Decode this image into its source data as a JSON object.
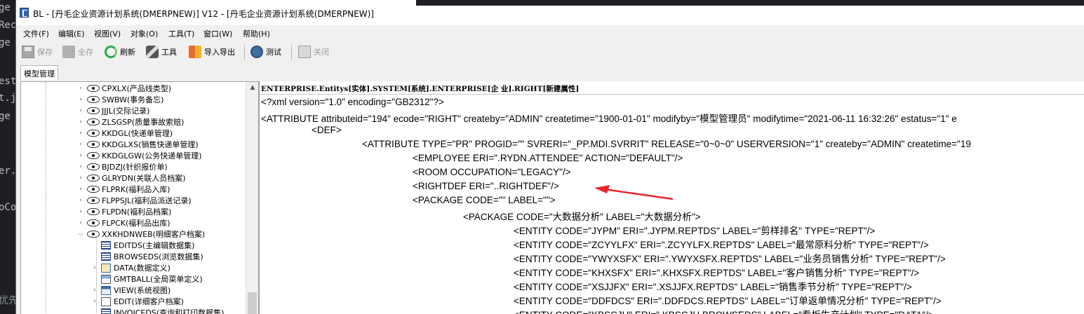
{
  "background_code": {
    "fragments": [
      "ge",
      "Rec",
      "ge",
      "est",
      "t.j",
      "ge",
      "er.",
      "oCo",
      "优先"
    ]
  },
  "window": {
    "title": "BL - [丹毛企业资源计划系统(DMERPNEW)] V12 - [丹毛企业资源计划系统(DMERPNEW)]",
    "icon": "app-icon"
  },
  "menu": [
    {
      "label": "文件(F)"
    },
    {
      "label": "编辑(E)"
    },
    {
      "label": "视图(V)"
    },
    {
      "label": "对象(O)"
    },
    {
      "label": "工具(T)"
    },
    {
      "label": "窗口(W)"
    },
    {
      "label": "帮助(H)"
    }
  ],
  "toolbar": {
    "save": {
      "label": "保存",
      "icon": "save-icon",
      "enabled": false
    },
    "save_all": {
      "label": "全存",
      "icon": "save-all-icon",
      "enabled": false
    },
    "refresh": {
      "label": "刷新",
      "icon": "refresh-icon",
      "enabled": true
    },
    "tools": {
      "label": "工具",
      "icon": "tools-icon",
      "enabled": true
    },
    "import_export": {
      "label": "导入导出",
      "icon": "import-export-icon",
      "enabled": true
    },
    "test": {
      "label": "测试",
      "icon": "test-icon",
      "enabled": true
    },
    "close": {
      "label": "关闭",
      "icon": "close-icon",
      "enabled": false
    }
  },
  "tabs": [
    {
      "label": "模型管理",
      "active": true
    }
  ],
  "tree": {
    "nodes": [
      {
        "label": "CPXLX(产品线类型)",
        "icon": "eye-icon",
        "expanded": false
      },
      {
        "label": "SWBW(事务备忘)",
        "icon": "eye-icon",
        "expanded": false
      },
      {
        "label": "JJJL(交际记录)",
        "icon": "eye-icon",
        "expanded": false
      },
      {
        "label": "ZLSGSP(质量事故索赔)",
        "icon": "eye-icon",
        "expanded": false
      },
      {
        "label": "KKDGL(快递单管理)",
        "icon": "eye-icon",
        "expanded": false
      },
      {
        "label": "KKDGLXS(销售快递单管理)",
        "icon": "eye-icon",
        "expanded": false
      },
      {
        "label": "KKDGLGW(公务快递单管理)",
        "icon": "eye-icon",
        "expanded": false
      },
      {
        "label": "BJDZJ(针织报价单)",
        "icon": "eye-icon",
        "expanded": false
      },
      {
        "label": "GLRYDN(关联人员档案)",
        "icon": "eye-icon",
        "expanded": false
      },
      {
        "label": "FLPRK(福利品入库)",
        "icon": "eye-icon",
        "expanded": false
      },
      {
        "label": "FLPPSJL(福利品派送记录)",
        "icon": "eye-icon",
        "expanded": false
      },
      {
        "label": "FLPDN(福利品档案)",
        "icon": "eye-icon",
        "expanded": false
      },
      {
        "label": "FLPCK(福利品出库)",
        "icon": "eye-icon",
        "expanded": false
      },
      {
        "label": "XXKHDNWEB(明细客户档案)",
        "icon": "eye-icon",
        "expanded": true
      },
      {
        "label": "EDITDS(主编辑数据集)",
        "icon": "table-icon",
        "child": true
      },
      {
        "label": "BROWSEDS(浏览数据集)",
        "icon": "table-icon",
        "child": true
      },
      {
        "label": "DATA(数据定义)",
        "icon": "data-icon",
        "child": true,
        "arrow": true
      },
      {
        "label": "GMTBALL(全局菜单定义)",
        "icon": "menu-def-icon",
        "child": true
      },
      {
        "label": "VIEW(系统视图)",
        "icon": "view-icon",
        "child": true,
        "arrow": true
      },
      {
        "label": "EDIT(详细客户档案)",
        "icon": "edit-icon",
        "child": true,
        "arrow": true
      },
      {
        "label": "INVOICEDS(查询和打印数据集)",
        "icon": "table-icon",
        "child": true
      }
    ]
  },
  "editor": {
    "path": "ENTERPRISE.Entitys[实体].SYSTEM[系统].ENTERPRISE[企 业].RIGHT[新建属性]",
    "lines": [
      "<?xml version=\"1.0\" encoding=\"GB2312\"?>",
      "<ATTRIBUTE attributeid=\"194\" ecode=\"RIGHT\" createby=\"ADMIN\" createtime=\"1900-01-01\" modifyby=\"模型管理员\" modifytime=\"2021-06-11 16:32:26\" estatus=\"1\" e",
      "<DEF>",
      "<ATTRIBUTE TYPE=\"PR\" PROGID=\"\" SVRERI=\"_PP.MDI.SVRRIT\" RELEASE=\"0~0~0\" USERVERSION=\"1\" createby=\"ADMIN\" createtime=\"19",
      "<EMPLOYEE ERI=\".RYDN.ATTENDEE\" ACTION=\"DEFAULT\"/>",
      "<ROOM OCCUPATION=\"LEGACY\"/>",
      "<RIGHTDEF ERI=\"..RIGHTDEF\"/>",
      "<PACKAGE CODE=\"\" LABEL=\"\">",
      "<PACKAGE CODE=\"大数据分析\" LABEL=\"大数据分析\">",
      "<ENTITY CODE=\"JYPM\" ERI=\".JYPM.REPTDS\" LABEL=\"剪样排名\" TYPE=\"REPT\"/>",
      "<ENTITY CODE=\"ZCYYLFX\" ERI=\".ZCYYLFX.REPTDS\" LABEL=\"最常原料分析\" TYPE=\"REPT\"/>",
      "<ENTITY CODE=\"YWYXSFX\" ERI=\".YWYXSFX.REPTDS\" LABEL=\"业务员销售分析\" TYPE=\"REPT\"/>",
      "<ENTITY CODE=\"KHXSFX\" ERI=\".KHXSFX.REPTDS\" LABEL=\"客户销售分析\" TYPE=\"REPT\"/>",
      "<ENTITY CODE=\"XSJJFX\" ERI=\".XSJJFX.REPTDS\" LABEL=\"销售季节分析\" TYPE=\"REPT\"/>",
      "<ENTITY CODE=\"DDFDCS\" ERI=\".DDFDCS.REPTDS\" LABEL=\"订单返单情况分析\" TYPE=\"REPT\"/>",
      "<ENTITY CODE=\"KBSCJH\" ERI=\".KBSCJH.BROWSEDS\" LABEL=\"看板生产计划\" TYPE=\"DATA\"/>"
    ]
  },
  "colors": {
    "annotation_arrow": "#e8262d",
    "background": "#1e1f22"
  }
}
